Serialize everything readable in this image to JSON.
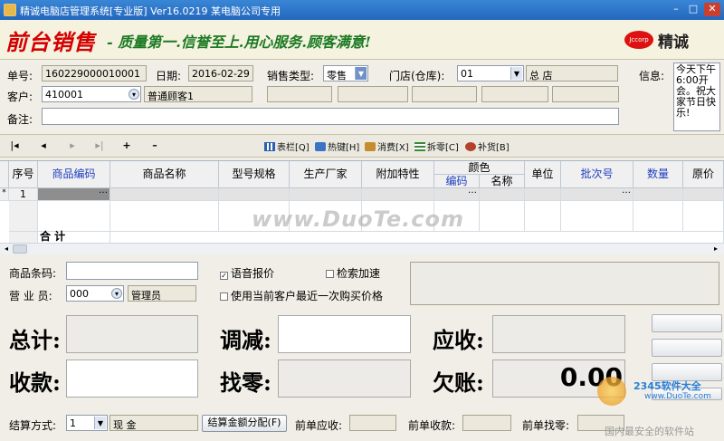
{
  "window": {
    "title": "精诚电脑店管理系统[专业版] Ver16.0219   某电脑公司专用",
    "controls": {
      "minimize": "–",
      "maximize": "□",
      "close": "✕"
    }
  },
  "banner": {
    "logo": "前台销售",
    "slogan": "- 质量第一.信誉至上.用心服务.顾客满意!",
    "corp_badge": "Jccorp",
    "brand": "精诚"
  },
  "form": {
    "order_no_label": "单号:",
    "order_no": "160229000010001",
    "date_label": "日期:",
    "date": "2016-02-29",
    "sale_type_label": "销售类型:",
    "sale_type": "零售",
    "store_label": "门店(仓库):",
    "store_code": "01",
    "store_name": "总   店",
    "info_label": "信息:",
    "info_text": "今天下午6:00开会。祝大家节日快乐!",
    "customer_label": "客户:",
    "customer_code": "410001",
    "customer_name": "普通顾客1",
    "remark_label": "备注:",
    "remark": ""
  },
  "toolbar": {
    "nav": [
      "|◂",
      "◂",
      "▸",
      "▸|",
      "+",
      "–"
    ],
    "buttons": [
      {
        "label": "表栏[Q]",
        "icon": "table-icon"
      },
      {
        "label": "热键[H]",
        "icon": "hotkey-icon"
      },
      {
        "label": "消费[X]",
        "icon": "consume-icon"
      },
      {
        "label": "拆零[C]",
        "icon": "split-icon"
      },
      {
        "label": "补货[B]",
        "icon": "restock-icon"
      }
    ]
  },
  "grid": {
    "columns": [
      "序号",
      "商品编码",
      "商品名称",
      "型号规格",
      "生产厂家",
      "附加特性",
      "颜色",
      "编码",
      "名称",
      "单位",
      "批次号",
      "数量",
      "原价"
    ],
    "row_index": "1",
    "total_label": "合   计"
  },
  "lower": {
    "barcode_label": "商品条码:",
    "barcode": "",
    "salesman_label": "营 业 员:",
    "salesman_code": "000",
    "salesman_name": "管理员",
    "voice_price": "语音报价",
    "search_speedup": "检索加速",
    "last_price": "使用当前客户最近一次购买价格",
    "total_label": "总计:",
    "adjust_label": "调减:",
    "receivable_label": "应收:",
    "collect_label": "收款:",
    "change_label": "找零:",
    "debt_label": "欠账:",
    "debt_amount": "0.00",
    "settle_label": "结算方式:",
    "settle_code": "1",
    "settle_name": "现   金",
    "distribute_btn": "结算金额分配(F)",
    "prev_receivable_label": "前单应收:",
    "prev_collect_label": "前单收款:",
    "prev_change_label": "前单找零:"
  },
  "watermark": {
    "main": "www.DuoTe.com",
    "corner_top": "2345软件大全",
    "corner_url": "www.DuoTe.com",
    "corner_bottom": "国内最安全的软件站"
  }
}
